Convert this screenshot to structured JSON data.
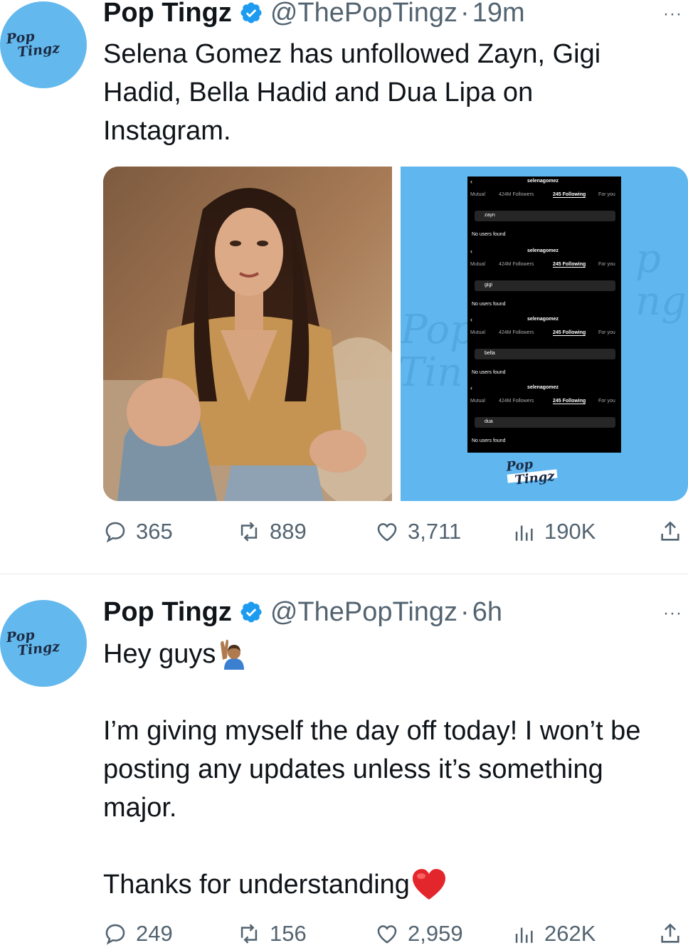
{
  "tweets": [
    {
      "author": "Pop Tingz",
      "handle": "@ThePopTingz",
      "separator": "·",
      "time": "19m",
      "more": "···",
      "avatar_text": [
        "Pop",
        "Tingz"
      ],
      "text": [
        "Selena Gomez has unfollowed Zayn, Gigi Hadid, Bella Hadid and Dua Lipa on Instagram."
      ],
      "media": {
        "screens": [
          {
            "account": "selenagomez",
            "tabs": [
              "Mutual",
              "424M Followers",
              "245 Following",
              "For you"
            ],
            "query": "zayn",
            "result": "No users found"
          },
          {
            "account": "selenagomez",
            "tabs": [
              "Mutual",
              "424M Followers",
              "245 Following",
              "For you"
            ],
            "query": "gigi",
            "result": "No users found"
          },
          {
            "account": "selenagomez",
            "tabs": [
              "Mutual",
              "424M Followers",
              "245 Following",
              "For you"
            ],
            "query": "bella",
            "result": "No users found"
          },
          {
            "account": "selenagomez",
            "tabs": [
              "Mutual",
              "424M Followers",
              "245 Following",
              "For you"
            ],
            "query": "dua",
            "result": "No users found"
          }
        ],
        "watermark": [
          "Pop",
          "Tingz"
        ]
      },
      "stats": {
        "replies": "365",
        "reposts": "889",
        "likes": "3,711",
        "views": "190K"
      }
    },
    {
      "author": "Pop Tingz",
      "handle": "@ThePopTingz",
      "separator": "·",
      "time": "6h",
      "more": "···",
      "avatar_text": [
        "Pop",
        "Tingz"
      ],
      "text": [
        "Hey guys",
        "I’m giving myself the day off today! I won’t be posting any updates unless it’s something major.",
        "Thanks for understanding"
      ],
      "emoji": [
        "raising-hand-emoji",
        "red-heart-emoji"
      ],
      "stats": {
        "replies": "249",
        "reposts": "156",
        "likes": "2,959",
        "views": "262K"
      }
    }
  ],
  "colors": {
    "verified": "#1d9bf0",
    "avatar_bg": "#63b9ed",
    "muted": "#536471",
    "heart": "#e0245e"
  }
}
